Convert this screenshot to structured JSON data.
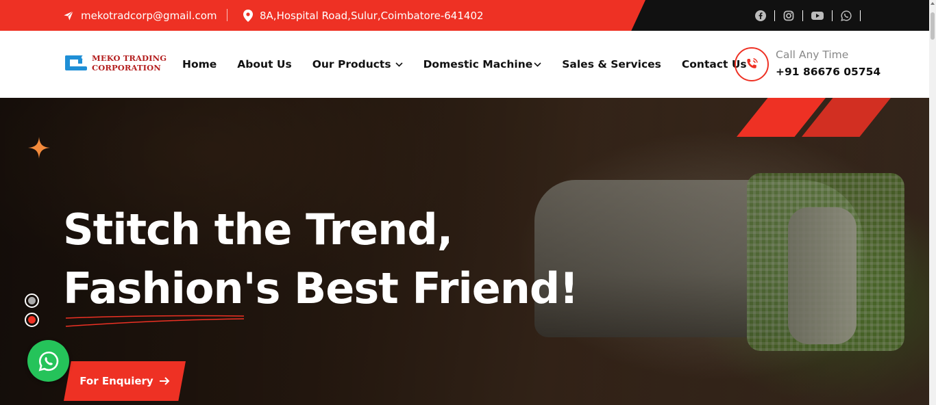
{
  "topbar": {
    "email": "mekotradcorp@gmail.com",
    "address": "8A,Hospital Road,Sulur,Coimbatore-641402",
    "socials": [
      "facebook-icon",
      "instagram-icon",
      "youtube-icon",
      "whatsapp-icon"
    ]
  },
  "logo": {
    "line1": "MEKO TRADING",
    "line2": "CORPORATION"
  },
  "nav": {
    "items": [
      {
        "label": "Home",
        "dropdown": false
      },
      {
        "label": "About Us",
        "dropdown": false
      },
      {
        "label": "Our Products",
        "dropdown": true
      },
      {
        "label": "Domestic Machine",
        "dropdown": true
      },
      {
        "label": "Sales & Services",
        "dropdown": false
      },
      {
        "label": "Contact Us",
        "dropdown": false
      }
    ]
  },
  "call": {
    "label": "Call Any Time",
    "number": "+91 86676 05754"
  },
  "hero": {
    "title_line1": "Stitch the Trend,",
    "title_line2": "Fashion's Best Friend!",
    "cta_label": "For Enquiery"
  },
  "colors": {
    "accent": "#ee3124",
    "topbar_dark": "#111111",
    "whatsapp": "#25c35a",
    "logo_text": "#b41f1f"
  }
}
